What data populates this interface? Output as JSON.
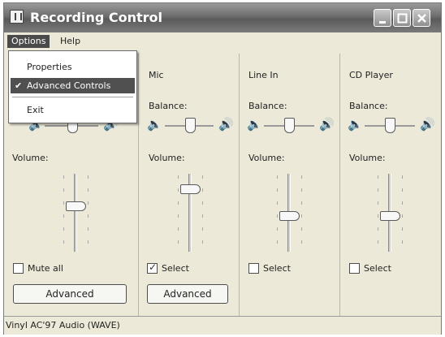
{
  "window": {
    "title": "Recording Control"
  },
  "menu": {
    "options": "Options",
    "help": "Help"
  },
  "options_menu": {
    "items": [
      "Properties",
      "Advanced Controls",
      "Exit"
    ],
    "checked_mark": "✔"
  },
  "labels": {
    "balance": "Balance:",
    "volume": "Volume:"
  },
  "columns": [
    {
      "name": "",
      "check_label": "Mute all",
      "checked": false,
      "button": "Advanced",
      "volume_level": 0.6
    },
    {
      "name": "Mic",
      "check_label": "Select",
      "checked": true,
      "button": "Advanced",
      "volume_level": 0.85
    },
    {
      "name": "Line In",
      "check_label": "Select",
      "checked": false,
      "button": "",
      "volume_level": 0.45
    },
    {
      "name": "CD Player",
      "check_label": "Select",
      "checked": false,
      "button": "",
      "volume_level": 0.45
    }
  ],
  "status": {
    "text": "Vinyl AC'97 Audio (WAVE)"
  },
  "colors": {
    "title_bar": "#6d6d6d",
    "menu_highlight": "#505050",
    "window_bg": "#ece9d8"
  }
}
